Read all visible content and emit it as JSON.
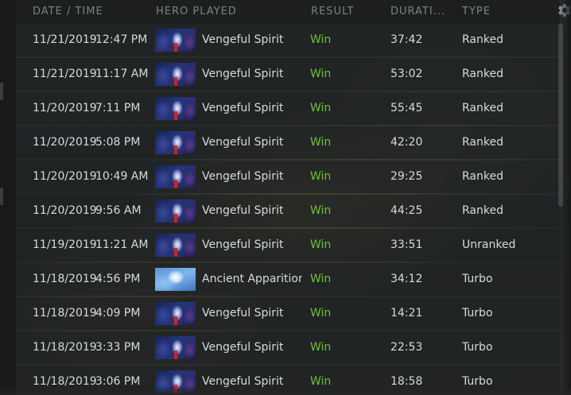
{
  "header": {
    "date_time": "DATE / TIME",
    "hero_played": "HERO PLAYED",
    "result": "RESULT",
    "duration": "DURATI...",
    "type": "TYPE",
    "settings_icon": "gear-icon"
  },
  "colors": {
    "win": "#6cc13a",
    "header_text": "#7b8386",
    "row_text": "#d7dbdc"
  },
  "matches": [
    {
      "date": "11/21/2019",
      "time": "12:47 PM",
      "hero": "Vengeful Spirit",
      "hero_icon": "vengeful-spirit-portrait",
      "result": "Win",
      "duration": "37:42",
      "type": "Ranked"
    },
    {
      "date": "11/21/2019",
      "time": "11:17 AM",
      "hero": "Vengeful Spirit",
      "hero_icon": "vengeful-spirit-portrait",
      "result": "Win",
      "duration": "53:02",
      "type": "Ranked"
    },
    {
      "date": "11/20/2019",
      "time": "7:11 PM",
      "hero": "Vengeful Spirit",
      "hero_icon": "vengeful-spirit-portrait",
      "result": "Win",
      "duration": "55:45",
      "type": "Ranked"
    },
    {
      "date": "11/20/2019",
      "time": "5:08 PM",
      "hero": "Vengeful Spirit",
      "hero_icon": "vengeful-spirit-portrait",
      "result": "Win",
      "duration": "42:20",
      "type": "Ranked"
    },
    {
      "date": "11/20/2019",
      "time": "10:49 AM",
      "hero": "Vengeful Spirit",
      "hero_icon": "vengeful-spirit-portrait",
      "result": "Win",
      "duration": "29:25",
      "type": "Ranked"
    },
    {
      "date": "11/20/2019",
      "time": "9:56 AM",
      "hero": "Vengeful Spirit",
      "hero_icon": "vengeful-spirit-portrait",
      "result": "Win",
      "duration": "44:25",
      "type": "Ranked"
    },
    {
      "date": "11/19/2019",
      "time": "11:21 AM",
      "hero": "Vengeful Spirit",
      "hero_icon": "vengeful-spirit-portrait",
      "result": "Win",
      "duration": "33:51",
      "type": "Unranked"
    },
    {
      "date": "11/18/2019",
      "time": "4:56 PM",
      "hero": "Ancient Apparition",
      "hero_icon": "ancient-apparition-portrait",
      "result": "Win",
      "duration": "34:12",
      "type": "Turbo"
    },
    {
      "date": "11/18/2019",
      "time": "4:09 PM",
      "hero": "Vengeful Spirit",
      "hero_icon": "vengeful-spirit-portrait",
      "result": "Win",
      "duration": "14:21",
      "type": "Turbo"
    },
    {
      "date": "11/18/2019",
      "time": "3:33 PM",
      "hero": "Vengeful Spirit",
      "hero_icon": "vengeful-spirit-portrait",
      "result": "Win",
      "duration": "22:53",
      "type": "Turbo"
    },
    {
      "date": "11/18/2019",
      "time": "3:06 PM",
      "hero": "Vengeful Spirit",
      "hero_icon": "vengeful-spirit-portrait",
      "result": "Win",
      "duration": "18:58",
      "type": "Turbo"
    }
  ]
}
